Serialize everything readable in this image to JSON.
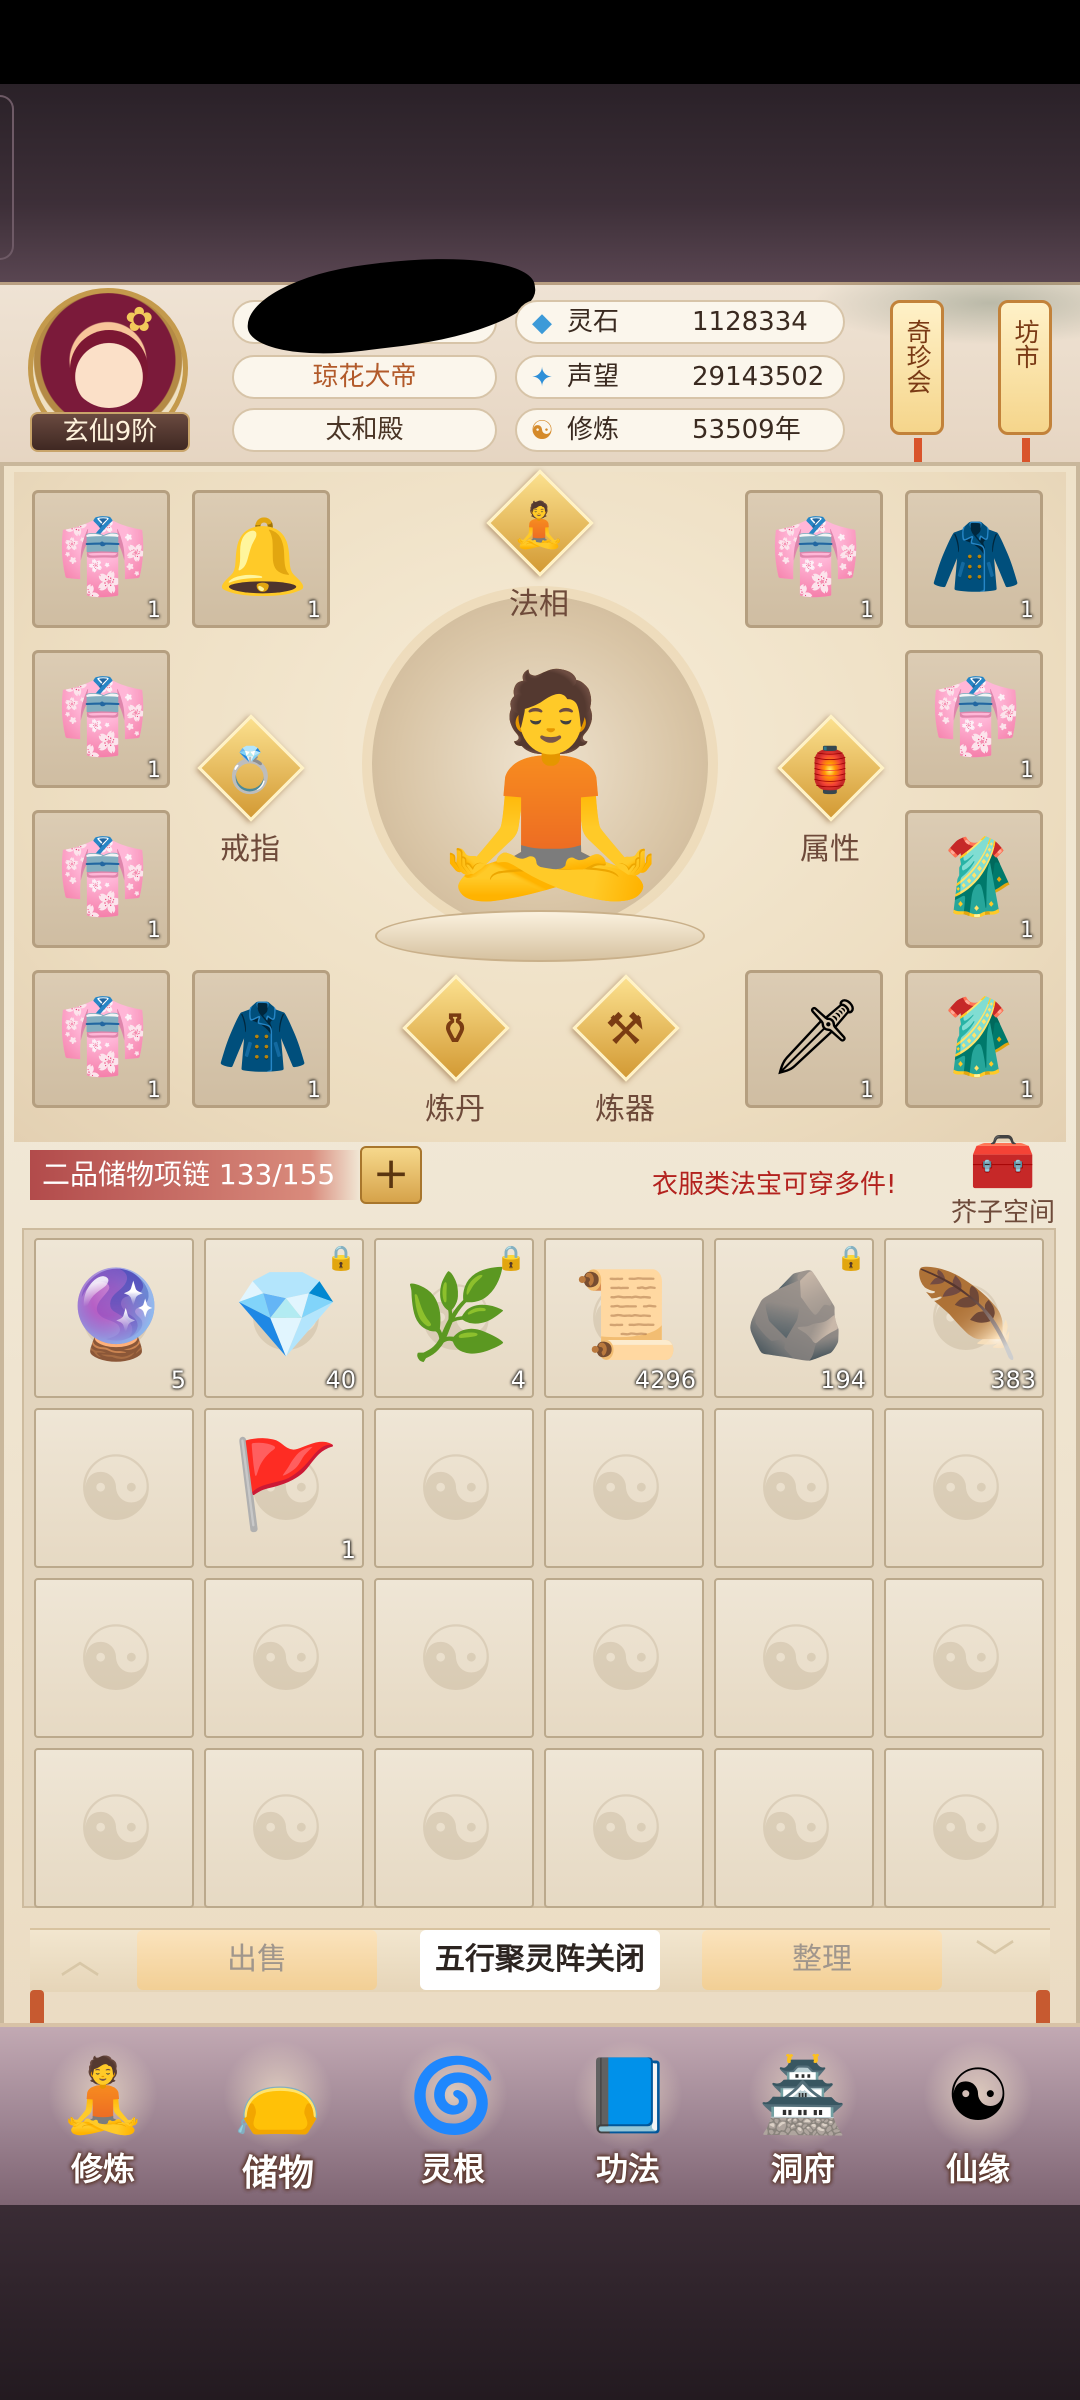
{
  "header": {
    "rank": "玄仙9阶",
    "title": "琼花大帝",
    "hall": "太和殿",
    "stats": [
      {
        "icon": "spirit-stone-icon",
        "glyph": "◆",
        "label": "灵石",
        "value": "1128334"
      },
      {
        "icon": "reputation-icon",
        "glyph": "✦",
        "label": "声望",
        "value": "29143502"
      },
      {
        "icon": "cultivation-icon",
        "glyph": "☯",
        "label": "修炼",
        "value": "53509年"
      }
    ],
    "lanterns": [
      {
        "label": "奇珍会"
      },
      {
        "label": "坊市"
      }
    ]
  },
  "equipment": {
    "buttons": {
      "faxiang": "法相",
      "jiezhi": "戒指",
      "shuxing": "属性",
      "liandan": "炼丹",
      "lianqi": "炼器"
    },
    "slots": [
      {
        "name": "robe-slot",
        "glyph": "👘",
        "count": "1"
      },
      {
        "name": "bell-armor-slot",
        "glyph": "🔔",
        "count": "1"
      },
      {
        "name": "robe-slot",
        "glyph": "👘",
        "count": "1"
      },
      {
        "name": "green-robe-slot",
        "glyph": "🧥",
        "count": "1"
      },
      {
        "name": "robe-slot",
        "glyph": "👘",
        "count": "1"
      },
      {
        "name": "robe-slot",
        "glyph": "👘",
        "count": "1"
      },
      {
        "name": "robe-slot",
        "glyph": "👘",
        "count": "1"
      },
      {
        "name": "red-robe-slot",
        "glyph": "🥻",
        "count": "1"
      },
      {
        "name": "robe-slot",
        "glyph": "👘",
        "count": "1"
      },
      {
        "name": "green-robe-slot",
        "glyph": "🧥",
        "count": "1"
      },
      {
        "name": "sword-slot",
        "glyph": "🗡",
        "count": "1"
      },
      {
        "name": "red-robe-slot",
        "glyph": "🥻",
        "count": "1"
      }
    ]
  },
  "storage": {
    "label": "二品储物项链 133/155",
    "plus": "+",
    "note": "衣服类法宝可穿多件!",
    "jiezi": "芥子空间",
    "yinyang": "☯",
    "items": [
      {
        "glyph": "🔮",
        "count": "5",
        "locked": false
      },
      {
        "glyph": "💎",
        "count": "40",
        "locked": true
      },
      {
        "glyph": "🌿",
        "count": "4",
        "locked": true
      },
      {
        "glyph": "📜",
        "count": "4296",
        "locked": false
      },
      {
        "glyph": "🪨",
        "count": "194",
        "locked": true
      },
      {
        "glyph": "🪶",
        "count": "383",
        "locked": false
      },
      {
        "glyph": "",
        "count": "",
        "locked": false
      },
      {
        "glyph": "🚩",
        "count": "1",
        "locked": false
      }
    ]
  },
  "actions": {
    "sell": "出售",
    "array": "五行聚灵阵关闭",
    "tidy": "整理",
    "prev": "︿",
    "next": "﹀"
  },
  "nav": [
    {
      "label": "修炼",
      "glyph": "🧘"
    },
    {
      "label": "储物",
      "glyph": "👝"
    },
    {
      "label": "灵根",
      "glyph": "🌀"
    },
    {
      "label": "功法",
      "glyph": "📘"
    },
    {
      "label": "洞府",
      "glyph": "🏯"
    },
    {
      "label": "仙缘",
      "glyph": "☯"
    }
  ]
}
